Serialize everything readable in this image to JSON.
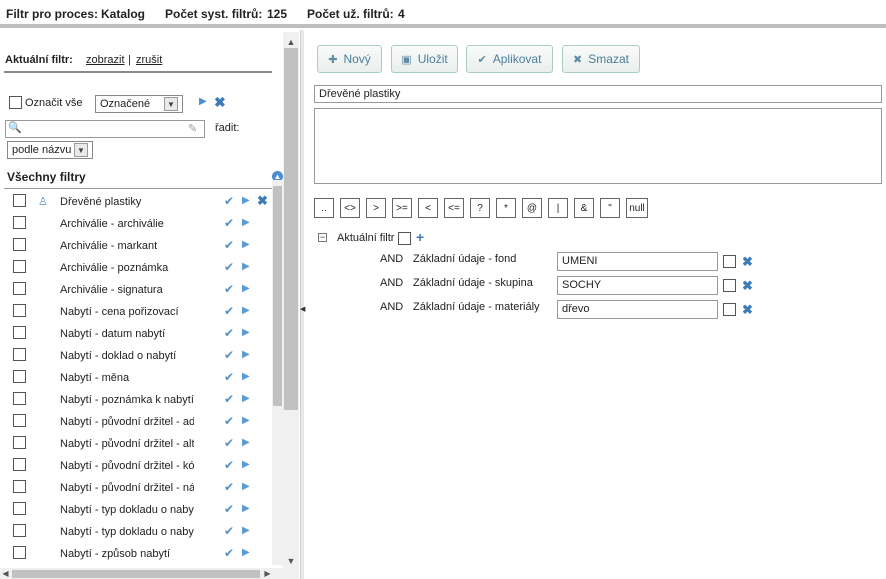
{
  "header": {
    "process_label": "Filtr pro proces:",
    "process_value": "Katalog",
    "sys_count_label": "Počet syst. filtrů:",
    "sys_count_value": "125",
    "user_count_label": "Počet už. filtrů:",
    "user_count_value": "4"
  },
  "left": {
    "current_filter_label": "Aktuální filtr:",
    "show_link": "zobrazit",
    "separator": "|",
    "cancel_link": "zrušit",
    "select_all_label": "Označit vše",
    "marked_select_value": "Označené",
    "sort_label": "řadit:",
    "sort_select_value": "podle názvu",
    "search_placeholder": "",
    "all_filters_heading": "Všechny filtry",
    "filters": [
      {
        "name": "Dřevěné plastiky",
        "user": true
      },
      {
        "name": "Archiválie - archiválie",
        "user": false
      },
      {
        "name": "Archiválie - markant",
        "user": false
      },
      {
        "name": "Archiválie - poznámka",
        "user": false
      },
      {
        "name": "Archiválie - signatura",
        "user": false
      },
      {
        "name": "Nabytí - cena pořizovací",
        "user": false
      },
      {
        "name": "Nabytí - datum nabytí",
        "user": false
      },
      {
        "name": "Nabytí - doklad o nabytí",
        "user": false
      },
      {
        "name": "Nabytí - měna",
        "user": false
      },
      {
        "name": "Nabytí - poznámka k nabytí",
        "user": false
      },
      {
        "name": "Nabytí - původní držitel - ad",
        "user": false
      },
      {
        "name": "Nabytí - původní držitel - alt",
        "user": false
      },
      {
        "name": "Nabytí - původní držitel - kó",
        "user": false
      },
      {
        "name": "Nabytí - původní držitel - ná",
        "user": false
      },
      {
        "name": "Nabytí - typ dokladu o naby",
        "user": false
      },
      {
        "name": "Nabytí - typ dokladu o naby",
        "user": false
      },
      {
        "name": "Nabytí - způsob nabytí",
        "user": false
      }
    ]
  },
  "right": {
    "buttons": {
      "new": "Nový",
      "save": "Uložit",
      "apply": "Aplikovat",
      "delete": "Smazat"
    },
    "filter_name": "Dřevěné plastiky",
    "filter_description": "",
    "operators": [
      "..",
      "<>",
      ">",
      ">=",
      "<",
      "<=",
      "?",
      "*",
      "@",
      "|",
      "&",
      "\"",
      "null"
    ],
    "tree_label": "Aktuální filtr",
    "conditions": [
      {
        "op": "AND",
        "field": "Základní údaje - fond",
        "value": "UMENI"
      },
      {
        "op": "AND",
        "field": "Základní údaje - skupina",
        "value": "SOCHY"
      },
      {
        "op": "AND",
        "field": "Základní údaje - materiály",
        "value": "dřevo"
      }
    ]
  }
}
